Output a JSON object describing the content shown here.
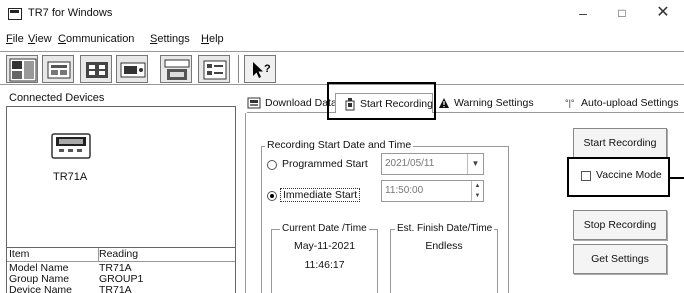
{
  "window": {
    "title": "TR7 for Windows",
    "minimize_glyph": "–",
    "maximize_glyph": "□",
    "close_glyph": "✕"
  },
  "menu": {
    "items": [
      {
        "ul": "F",
        "rest": "ile"
      },
      {
        "ul": "V",
        "rest": "iew"
      },
      {
        "ul": "C",
        "rest": "ommunication"
      },
      {
        "ul": "S",
        "rest": "ettings"
      },
      {
        "ul": "H",
        "rest": "elp"
      }
    ]
  },
  "toolbar": {
    "buttons": [
      "tandd-logo-icon",
      "device-list-icon",
      "grid-view-icon",
      "recording-device-icon",
      "new-config-icon",
      "list-settings-icon",
      "context-help-icon"
    ]
  },
  "left_panel": {
    "title": "Connected Devices",
    "device_label": "TR71A",
    "table": {
      "headers": [
        "Item",
        "Reading"
      ],
      "rows": [
        [
          "Model Name",
          "TR71A"
        ],
        [
          "Group Name",
          "GROUP1"
        ],
        [
          "Device Name",
          "TR71A"
        ]
      ]
    }
  },
  "tabs": {
    "download": "Download Data",
    "start": "Start Recording",
    "warning": "Warning Settings",
    "upload": "Auto-upload Settings",
    "active": "start"
  },
  "recording": {
    "group_title": "Recording Start Date and Time",
    "programmed_label": "Programmed Start",
    "programmed_date": "2021/05/11",
    "immediate_label": "Immediate Start",
    "immediate_time": "11:50:00",
    "selected": "immediate",
    "current_title": "Current Date /Time",
    "current_date": "May-11-2021",
    "current_time": "11:46:17",
    "finish_title": "Est. Finish Date/Time",
    "finish_value": "Endless"
  },
  "actions": {
    "start": "Start Recording",
    "vaccine": "Vaccine Mode",
    "vaccine_checked": false,
    "stop": "Stop Recording",
    "get": "Get Settings"
  }
}
